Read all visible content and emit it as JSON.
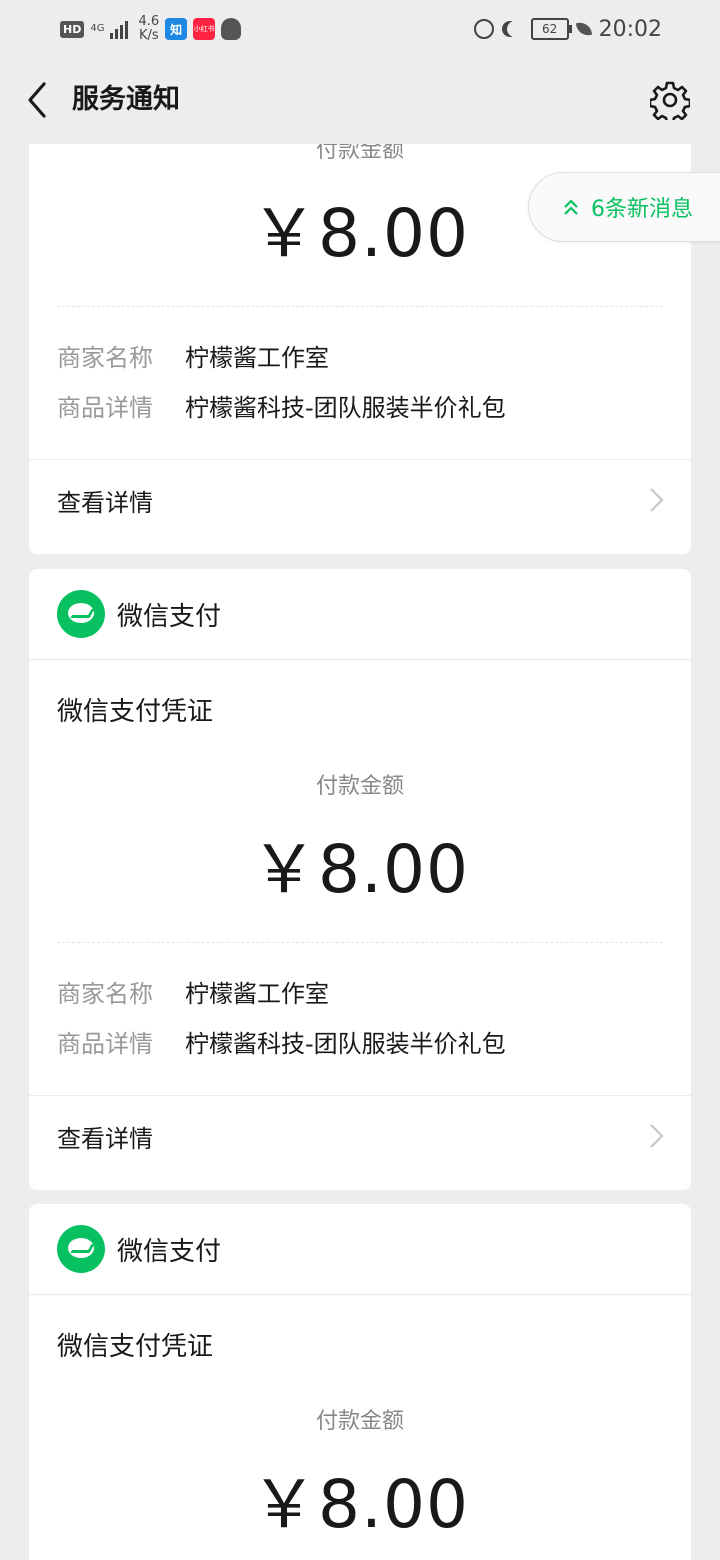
{
  "status_bar": {
    "hd": "HD",
    "network": "4G",
    "speed_value": "4.6",
    "speed_unit": "K/s",
    "app_zhihu": "知",
    "app_xhs": "小红书",
    "battery": "62",
    "time": "20:02"
  },
  "nav": {
    "title": "服务通知"
  },
  "new_messages": {
    "label": "6条新消息",
    "accent_color": "#07c160"
  },
  "cards": [
    {
      "brand": "",
      "title": "",
      "amount_label": "付款金额",
      "amount": "￥8.00",
      "merchant_key": "商家名称",
      "merchant": "柠檬酱工作室",
      "product_key": "商品详情",
      "product": "柠檬酱科技-团队服装半价礼包",
      "details": "查看详情"
    },
    {
      "brand": "微信支付",
      "title": "微信支付凭证",
      "amount_label": "付款金额",
      "amount": "￥8.00",
      "merchant_key": "商家名称",
      "merchant": "柠檬酱工作室",
      "product_key": "商品详情",
      "product": "柠檬酱科技-团队服装半价礼包",
      "details": "查看详情"
    },
    {
      "brand": "微信支付",
      "title": "微信支付凭证",
      "amount_label": "付款金额",
      "amount": "￥8.00"
    }
  ]
}
